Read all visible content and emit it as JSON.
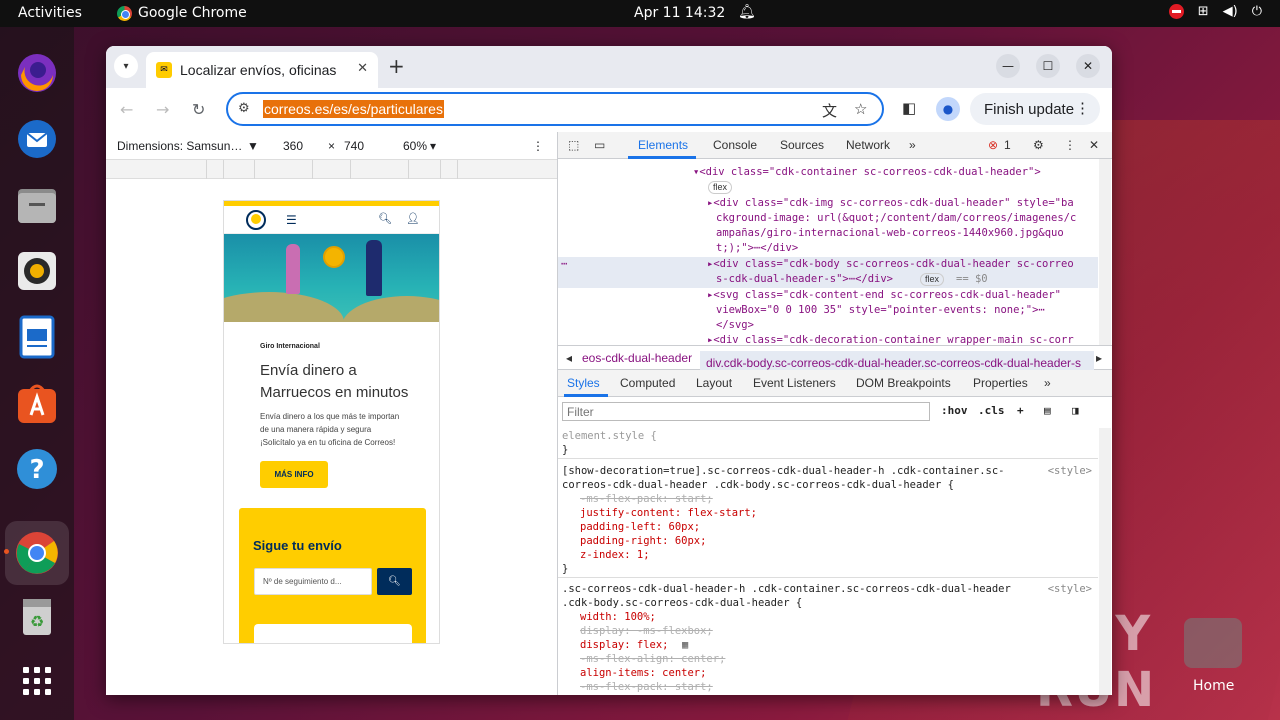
{
  "topbar": {
    "activities": "Activities",
    "app_name": "Google Chrome",
    "clock": "Apr 11  14:32"
  },
  "dock": [
    "Firefox",
    "Thunderbird",
    "Files",
    "Rhythmbox",
    "LibreOffice Writer",
    "App Center",
    "Help",
    "Google Chrome",
    "Trash",
    "Show Applications"
  ],
  "watermark": {
    "text": "ANY RUN",
    "home_label": "Home"
  },
  "browser": {
    "tab_title": "Localizar envíos, oficinas",
    "url": "correos.es/es/es/particulares",
    "finish_update": "Finish update"
  },
  "device_toolbar": {
    "dimensions": "Dimensions: Samsun…",
    "width": "360",
    "times": "×",
    "height": "740",
    "zoom": "60%"
  },
  "page": {
    "eyebrow": "Giro Internacional",
    "title": "Envía dinero a Marruecos en minutos",
    "text": "Envía dinero a los que más te importan de una manera rápida y segura ¡Solicítalo ya en tu oficina de Correos!",
    "cta": "MÁS INFO",
    "track_title": "Sigue tu envío",
    "track_placeholder": "Nº de seguimiento d..."
  },
  "devtools": {
    "tabs": [
      "Elements",
      "Console",
      "Sources",
      "Network"
    ],
    "error_count": "1",
    "breadcrumb_left": "eos-cdk-dual-header",
    "breadcrumb_selected": "div.cdk-body.sc-correos-cdk-dual-header.sc-correos-cdk-dual-header-s",
    "styles_tabs": [
      "Styles",
      "Computed",
      "Layout",
      "Event Listeners",
      "DOM Breakpoints",
      "Properties"
    ],
    "filter_placeholder": "Filter",
    "hov": ":hov",
    "cls": ".cls",
    "flex_badge": "flex",
    "eq0": "== $0",
    "dom_lines": [
      "▾<div class=\"cdk-container sc-correos-cdk-dual-header\">",
      "▸<div class=\"cdk-img sc-correos-cdk-dual-header\" style=\"ba",
      "ckground-image: url(&quot;/content/dam/correos/imagenes/c",
      "ampañas/giro-internacional-web-correos-1440x960.jpg&quo",
      "t;);\">⋯</div>",
      "▸<div class=\"cdk-body sc-correos-cdk-dual-header sc-correo",
      "s-cdk-dual-header-s\">⋯</div>",
      "▸<svg class=\"cdk-content-end sc-correos-cdk-dual-header\"",
      "viewBox=\"0 0 100 35\" style=\"pointer-events: none;\">⋯",
      "</svg>",
      "▸<div class=\"cdk-decoration-container wrapper-main sc-corr"
    ],
    "css_lines": [
      "element.style {",
      "}",
      "[show-decoration=true].sc-correos-cdk-dual-header-h .cdk-container.sc-",
      "correos-cdk-dual-header .cdk-body.sc-correos-cdk-dual-header {",
      "-ms-flex-pack: start;",
      "justify-content: flex-start;",
      "padding-left: 60px;",
      "padding-right: 60px;",
      "z-index: 1;",
      "}",
      ".sc-correos-cdk-dual-header-h .cdk-container.sc-correos-cdk-dual-header",
      ".cdk-body.sc-correos-cdk-dual-header {",
      "width: 100%;",
      "display: -ms-flexbox;",
      "display: flex;",
      "-ms-flex-align: center;",
      "align-items: center;",
      "-ms-flex-pack: start;"
    ],
    "style_src": "<style>"
  }
}
